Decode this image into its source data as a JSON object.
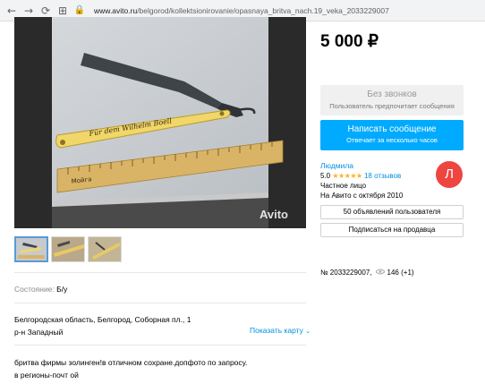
{
  "browser": {
    "url_host": "www.avito.ru",
    "url_path": "/belgorod/kollektsionirovanie/opasnaya_britva_nach.19_veka_2033229007"
  },
  "gallery": {
    "watermark": "Avito",
    "ruler_brand": "Мойга",
    "engraving": "Für dem Wilhelm Boell"
  },
  "product": {
    "condition_label": "Состояние:",
    "condition_value": "Б/у",
    "address_line1": "Белгородская область, Белгород, Соборная пл., 1",
    "address_line2": "р-н Западный",
    "map_link": "Показать карту",
    "description_line1": "бритва фирмы золинген!в отличном сохране.допфото по запросу.",
    "description_line2": "в регионы-почт ой"
  },
  "sidebar": {
    "price": "5 000 ₽",
    "no_calls_title": "Без звонков",
    "no_calls_subtitle": "Пользователь предпочитает сообщения",
    "message_button": "Написать сообщение",
    "message_subtitle": "Отвечает за несколько часов",
    "seller_name": "Людмила",
    "rating_value": "5.0",
    "stars": "★★★★★",
    "reviews": "18 отзывов",
    "seller_type": "Частное лицо",
    "seller_since": "На Авито с октября 2010",
    "avatar_letter": "Л",
    "listings_button": "50 объявлений пользователя",
    "subscribe_button": "Подписаться на продавца",
    "item_number": "№ 2033229007,",
    "views": "146 (+1)"
  },
  "colors": {
    "accent": "#00aaff",
    "link": "#0091e0",
    "avatar": "#ef4540",
    "star": "#ffb021"
  }
}
